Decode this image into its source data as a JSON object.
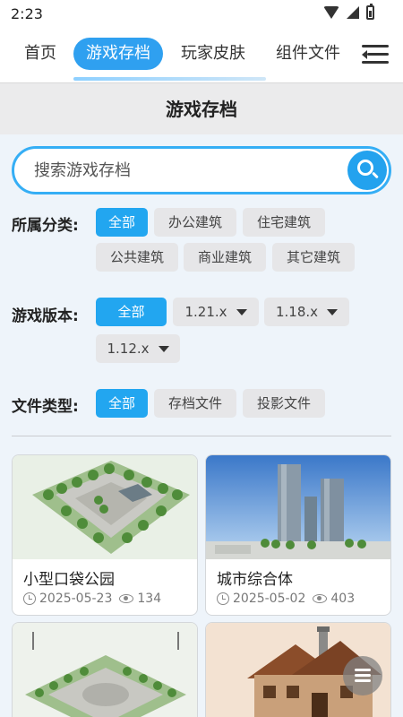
{
  "status_bar": {
    "time": "2:23"
  },
  "nav": {
    "tabs": [
      {
        "label": "首页"
      },
      {
        "label": "游戏存档",
        "active": true
      },
      {
        "label": "玩家皮肤"
      },
      {
        "label": "组件文件"
      }
    ],
    "menu_icon": "menu-collapse-icon"
  },
  "page_title": "游戏存档",
  "search": {
    "placeholder": "搜索游戏存档",
    "value": "",
    "icon": "search-icon"
  },
  "filters": {
    "category": {
      "label": "所属分类:",
      "options": [
        "全部",
        "办公建筑",
        "住宅建筑",
        "公共建筑",
        "商业建筑",
        "其它建筑"
      ],
      "selected": "全部"
    },
    "version": {
      "label": "游戏版本:",
      "options": [
        "全部",
        "1.21.x",
        "1.18.x",
        "1.12.x"
      ],
      "selected": "全部"
    },
    "file_type": {
      "label": "文件类型:",
      "options": [
        "全部",
        "存档文件",
        "投影文件"
      ],
      "selected": "全部"
    }
  },
  "cards": [
    {
      "title": "小型口袋公园",
      "date": "2025-05-23",
      "views": "134"
    },
    {
      "title": "城市综合体",
      "date": "2025-05-02",
      "views": "403"
    },
    {
      "title": "",
      "date": "",
      "views": ""
    },
    {
      "title": "",
      "date": "",
      "views": ""
    }
  ],
  "colors": {
    "accent": "#22a6f0",
    "chip_bg": "#e6e6e8",
    "page_bg": "#eef4fa"
  }
}
